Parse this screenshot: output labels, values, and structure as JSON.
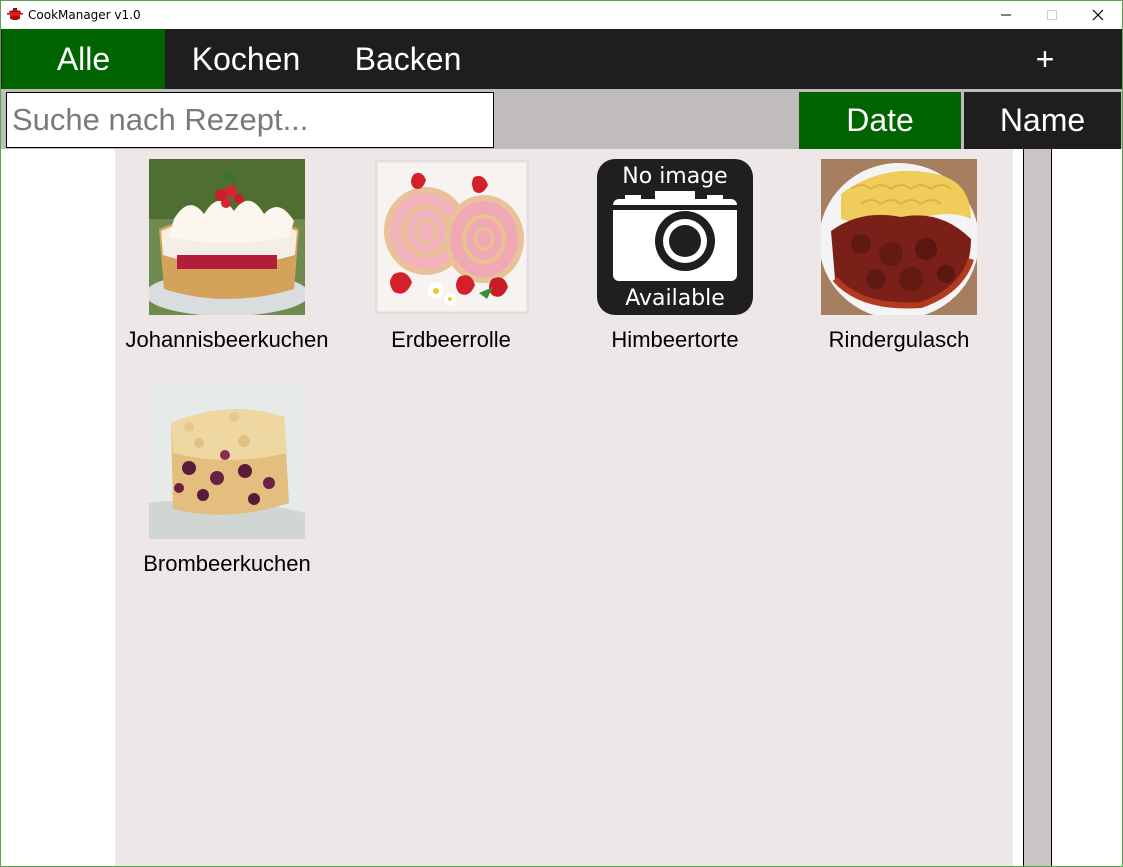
{
  "window": {
    "title": "CookManager v1.0",
    "controls": {
      "minimize": "minimize-icon",
      "maximize": "maximize-icon",
      "close": "close-icon"
    }
  },
  "nav": {
    "tabs": [
      {
        "label": "Alle",
        "active": true
      },
      {
        "label": "Kochen",
        "active": false
      },
      {
        "label": "Backen",
        "active": false
      }
    ],
    "add_label": "+"
  },
  "search": {
    "placeholder": "Suche nach Rezept...",
    "value": ""
  },
  "sort": {
    "date_label": "Date",
    "name_label": "Name",
    "active": "Date"
  },
  "recipes": [
    {
      "name": "Johannisbeerkuchen",
      "image": "cake-photo"
    },
    {
      "name": "Erdbeerrolle",
      "image": "strawberry-roll-photo"
    },
    {
      "name": "Himbeertorte",
      "image": "no-image-placeholder",
      "placeholder_line1": "No image",
      "placeholder_line2": "Available"
    },
    {
      "name": "Rindergulasch",
      "image": "goulash-photo"
    },
    {
      "name": "Brombeerkuchen",
      "image": "crumble-cake-photo"
    }
  ],
  "colors": {
    "accent": "#006400",
    "nav_background": "#1e1e1e",
    "search_bar_background": "#c0bcbc",
    "content_background": "#ede7e7",
    "scrollbar": "#cac4c4"
  }
}
